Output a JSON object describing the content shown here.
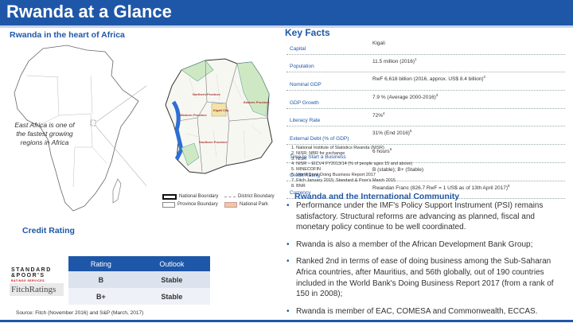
{
  "header": {
    "title": "Rwanda at a Glance"
  },
  "left": {
    "section_title": "Rwanda in the heart of Africa",
    "east_africa_note": "East Africa is one of the fastest growing regions in Africa",
    "legend": {
      "national_boundary": "National Boundary",
      "district_boundary": "District Boundary",
      "province_boundary": "Province Boundary",
      "national_park": "National Park"
    },
    "map_labels": {
      "northern": "Northern Province",
      "eastern": "Eastern Province",
      "western": "Western Province",
      "kigali": "Kigali City",
      "southern": "Southern Province"
    }
  },
  "credit": {
    "section_title": "Credit Rating",
    "col_rating": "Rating",
    "col_outlook": "Outlook",
    "rows": [
      {
        "rating": "B",
        "outlook": "Stable"
      },
      {
        "rating": "B+",
        "outlook": "Stable"
      }
    ],
    "sp_logo_line1": "STANDARD",
    "sp_logo_line2": "&POOR'S",
    "sp_logo_sub": "RATINGS SERVICES",
    "fitch_logo": "FitchRatings",
    "source": "Source: Fitch (November 2016) and S&P (March, 2017)"
  },
  "key_facts": {
    "title": "Key Facts",
    "rows": [
      {
        "label": "Capital",
        "value": "Kigali",
        "sup": ""
      },
      {
        "label": "Population",
        "value": "11.5 million (2016)",
        "sup": "1"
      },
      {
        "label": "Nominal GDP",
        "value": "RwF 6,618 billion (2016, approx. US$ 8.4 billion)",
        "sup": "2"
      },
      {
        "label": "GDP Growth",
        "value": "7.9 % (Average 2000-2016)",
        "sup": "3"
      },
      {
        "label": "Literacy Rate",
        "value": "72%",
        "sup": "4"
      },
      {
        "label": "External Debt (% of GDP)",
        "value": "31% (End 2016)",
        "sup": "5"
      },
      {
        "label": "Time to Start a Business",
        "value": "6 hours",
        "sup": "6"
      },
      {
        "label": "Credit Rating",
        "value": "B (stable); B+ (Stable)",
        "sup": ""
      },
      {
        "label": "Currency",
        "value": "Rwandan Franc (826.7 RwF = 1 US$ as of 13th April 2017)",
        "sup": "8"
      }
    ],
    "notes": [
      "1. National Institute of Statistics Rwanda (NISR)",
      "2. NISR; NBR for exchange",
      "3. NISR",
      "4. NISR – EICV4 FY2013/14 (% of people ages 15 and above)",
      "5. MINECOFIN",
      "6. World Bank Doing Business Report 2017",
      "7. Fitch January 2015; Standard & Poor's March 2015",
      "8. BNR"
    ]
  },
  "community": {
    "title": "Rwanda and the International Community",
    "bullets": [
      "Performance under the IMF's Policy Support Instrument (PSI) remains satisfactory. Structural reforms are advancing as planned, fiscal and monetary policy continue to be well coordinated.",
      "Rwanda is also a member of the African Development Bank Group;",
      "Ranked 2nd in terms of ease of doing business among the Sub-Saharan Africa countries, after Mauritius, and 56th globally, out of 190 countries included in the World Bank's Doing Business Report 2017 (from a rank of 150 in 2008);",
      "Rwanda is member of EAC, COMESA and Commonwealth, ECCAS."
    ]
  },
  "colors": {
    "brand_blue": "#1f57a8",
    "section_title": "#1f57a8"
  }
}
